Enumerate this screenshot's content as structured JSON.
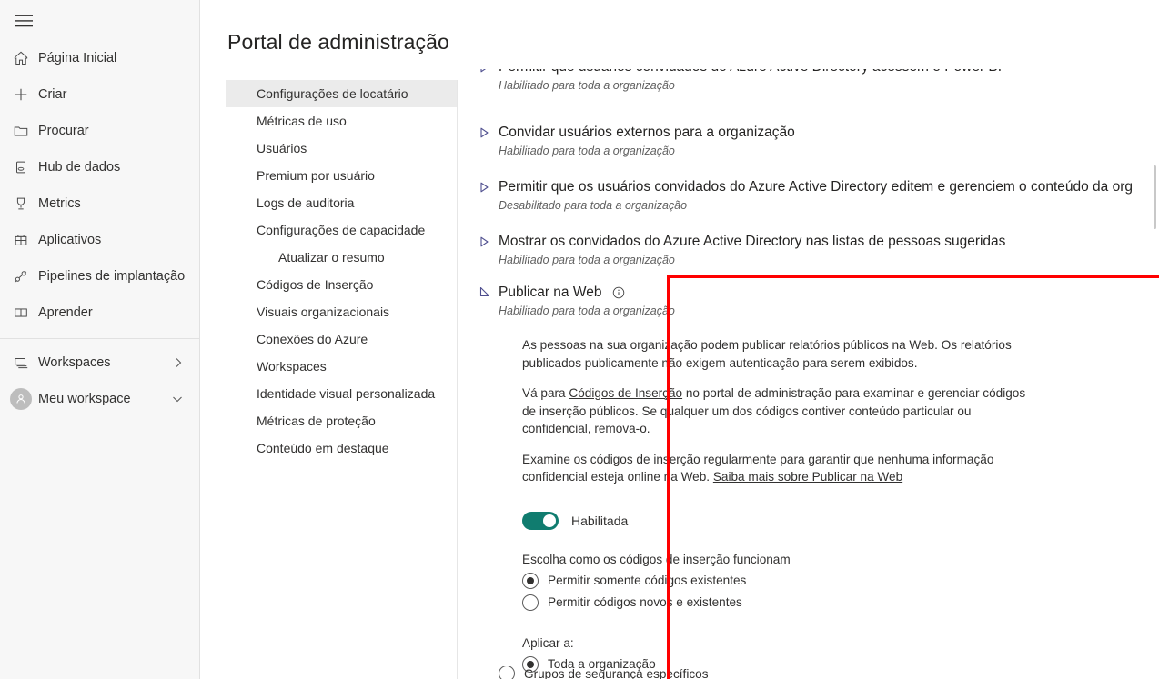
{
  "left_nav": {
    "menu_toggle": "hamburger-menu",
    "items": [
      {
        "icon": "home-icon",
        "label": "Página Inicial"
      },
      {
        "icon": "plus-icon",
        "label": "Criar"
      },
      {
        "icon": "folder-icon",
        "label": "Procurar"
      },
      {
        "icon": "database-icon",
        "label": "Hub de dados"
      },
      {
        "icon": "metrics-icon",
        "label": "Metrics"
      },
      {
        "icon": "apps-icon",
        "label": "Aplicativos"
      },
      {
        "icon": "pipeline-icon",
        "label": "Pipelines de implantação"
      },
      {
        "icon": "book-icon",
        "label": "Aprender"
      }
    ],
    "bottom_items": [
      {
        "icon": "workspaces-icon",
        "label": "Workspaces",
        "chevron": "chevron-right-icon"
      },
      {
        "icon": "avatar-icon",
        "label": "Meu workspace",
        "chevron": "chevron-down-icon"
      }
    ]
  },
  "header": {
    "title": "Portal de administração"
  },
  "subnav": {
    "items": [
      {
        "label": "Configurações de locatário",
        "selected": true,
        "indent": false
      },
      {
        "label": "Métricas de uso",
        "selected": false,
        "indent": false
      },
      {
        "label": "Usuários",
        "selected": false,
        "indent": false
      },
      {
        "label": "Premium por usuário",
        "selected": false,
        "indent": false
      },
      {
        "label": "Logs de auditoria",
        "selected": false,
        "indent": false
      },
      {
        "label": "Configurações de capacidade",
        "selected": false,
        "indent": false
      },
      {
        "label": "Atualizar o resumo",
        "selected": false,
        "indent": true
      },
      {
        "label": "Códigos de Inserção",
        "selected": false,
        "indent": false
      },
      {
        "label": "Visuais organizacionais",
        "selected": false,
        "indent": false
      },
      {
        "label": "Conexões do Azure",
        "selected": false,
        "indent": false
      },
      {
        "label": "Workspaces",
        "selected": false,
        "indent": false
      },
      {
        "label": "Identidade visual personalizada",
        "selected": false,
        "indent": false
      },
      {
        "label": "Métricas de proteção",
        "selected": false,
        "indent": false
      },
      {
        "label": "Conteúdo em destaque",
        "selected": false,
        "indent": false
      }
    ]
  },
  "settings": {
    "collapsed_rows": [
      {
        "title": "Permitir que usuários convidados do Azure Active Directory acessem o Power BI",
        "status": "Habilitado para toda a organização",
        "expand_icon": "triangle-right-icon"
      },
      {
        "title": "Convidar usuários externos para a organização",
        "status": "Habilitado para toda a organização",
        "expand_icon": "triangle-right-icon"
      },
      {
        "title": "Permitir que os usuários convidados do Azure Active Directory editem e gerenciem o conteúdo da org",
        "status": "Desabilitado para toda a organização",
        "expand_icon": "triangle-right-icon"
      },
      {
        "title": "Mostrar os convidados do Azure Active Directory nas listas de pessoas sugeridas",
        "status": "Habilitado para toda a organização",
        "expand_icon": "triangle-right-icon"
      }
    ],
    "publish_to_web": {
      "title": "Publicar na Web",
      "info_icon": "info-icon",
      "collapse_icon": "triangle-expanded-icon",
      "status": "Habilitado para toda a organização",
      "paragraph_1": "As pessoas na sua organização podem publicar relatórios públicos na Web. Os relatórios publicados publicamente não exigem autenticação para serem exibidos.",
      "paragraph_2_prefix": "Vá para ",
      "paragraph_2_link": "Códigos de Inserção",
      "paragraph_2_suffix": " no portal de administração para examinar e gerenciar códigos de inserção públicos. Se qualquer um dos códigos contiver conteúdo particular ou confidencial, remova-o.",
      "paragraph_3_prefix": "Examine os códigos de inserção regularmente para garantir que nenhuma informação confidencial esteja online na Web. ",
      "paragraph_3_link": "Saiba mais sobre Publicar na Web",
      "toggle": {
        "state": "on",
        "label": "Habilitada"
      },
      "embed_group_label": "Escolha como os códigos de inserção funcionam",
      "embed_options": [
        {
          "label": "Permitir somente códigos existentes",
          "checked": true
        },
        {
          "label": "Permitir códigos novos e existentes",
          "checked": false
        }
      ],
      "apply_group_label": "Aplicar a:",
      "apply_options": [
        {
          "label": "Toda a organização",
          "checked": true
        },
        {
          "label": "Grupos de segurança específicos",
          "checked": false
        }
      ]
    }
  },
  "scrollbar": {
    "name": "vertical-scrollbar"
  },
  "colors": {
    "highlight_border": "#ff0000",
    "toggle_on": "#107c6f",
    "selected_nav_bg": "#ebebeb",
    "panel_bg": "#f7f7f7",
    "text": "#323130"
  }
}
